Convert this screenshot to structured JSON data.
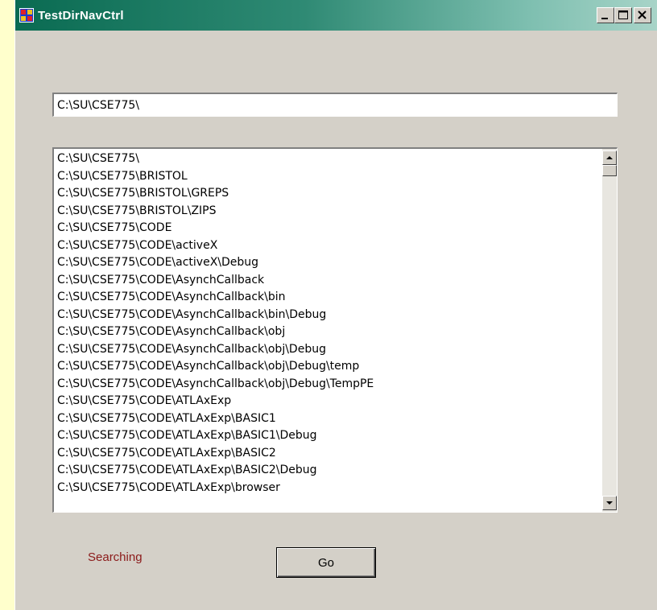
{
  "window": {
    "title": "TestDirNavCtrl"
  },
  "path_input": {
    "value": "C:\\SU\\CSE775\\"
  },
  "directory_list": {
    "items": [
      "C:\\SU\\CSE775\\",
      "C:\\SU\\CSE775\\BRISTOL",
      "C:\\SU\\CSE775\\BRISTOL\\GREPS",
      "C:\\SU\\CSE775\\BRISTOL\\ZIPS",
      "C:\\SU\\CSE775\\CODE",
      "C:\\SU\\CSE775\\CODE\\activeX",
      "C:\\SU\\CSE775\\CODE\\activeX\\Debug",
      "C:\\SU\\CSE775\\CODE\\AsynchCallback",
      "C:\\SU\\CSE775\\CODE\\AsynchCallback\\bin",
      "C:\\SU\\CSE775\\CODE\\AsynchCallback\\bin\\Debug",
      "C:\\SU\\CSE775\\CODE\\AsynchCallback\\obj",
      "C:\\SU\\CSE775\\CODE\\AsynchCallback\\obj\\Debug",
      "C:\\SU\\CSE775\\CODE\\AsynchCallback\\obj\\Debug\\temp",
      "C:\\SU\\CSE775\\CODE\\AsynchCallback\\obj\\Debug\\TempPE",
      "C:\\SU\\CSE775\\CODE\\ATLAxExp",
      "C:\\SU\\CSE775\\CODE\\ATLAxExp\\BASIC1",
      "C:\\SU\\CSE775\\CODE\\ATLAxExp\\BASIC1\\Debug",
      "C:\\SU\\CSE775\\CODE\\ATLAxExp\\BASIC2",
      "C:\\SU\\CSE775\\CODE\\ATLAxExp\\BASIC2\\Debug",
      "C:\\SU\\CSE775\\CODE\\ATLAxExp\\browser"
    ]
  },
  "status": {
    "text": "Searching",
    "color": "#8b1a1a"
  },
  "go_button": {
    "label": "Go"
  },
  "icons": {
    "app": "app-window-icon",
    "minimize": "minimize-icon",
    "maximize": "maximize-icon",
    "close": "close-icon",
    "scroll_up": "scroll-up-arrow-icon",
    "scroll_down": "scroll-down-arrow-icon"
  }
}
